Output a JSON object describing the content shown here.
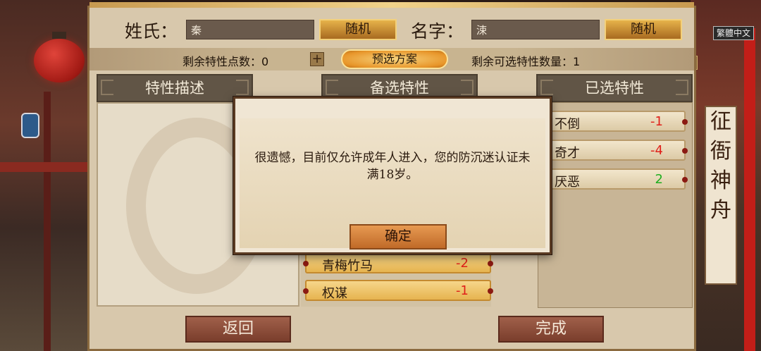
{
  "header": {
    "surname_label": "姓氏：",
    "surname_value": "秦",
    "surname_random": "随机",
    "given_label": "名字：",
    "given_value": "涑",
    "given_random": "随机"
  },
  "stats": {
    "remaining_points_label": "剩余特性点数：0",
    "preset_button": "预选方案",
    "remaining_count_label": "剩余可选特性数量：1"
  },
  "columns": {
    "description": "特性描述",
    "candidates": "备选特性",
    "selected": "已选特性"
  },
  "candidate_traits": [
    {
      "name": "青梅竹马",
      "value": "-2"
    },
    {
      "name": "权谋",
      "value": "-1"
    }
  ],
  "selected_traits": [
    {
      "name": "不倒",
      "value": "-1"
    },
    {
      "name": "奇才",
      "value": "-4"
    },
    {
      "name": "厌恶",
      "value": "2"
    }
  ],
  "footer": {
    "back": "返回",
    "done": "完成"
  },
  "dialog": {
    "message": "很遗憾，目前仅允许成年人进入，您的防沉迷认证未满18岁。",
    "ok": "确定"
  },
  "lang": {
    "prev_char": "文",
    "button": "繁體中文"
  },
  "banner_text": "征衙神舟",
  "colors": {
    "negative": "#e0201a",
    "positive": "#1fae1f",
    "gold_button": "#e6b24a"
  }
}
